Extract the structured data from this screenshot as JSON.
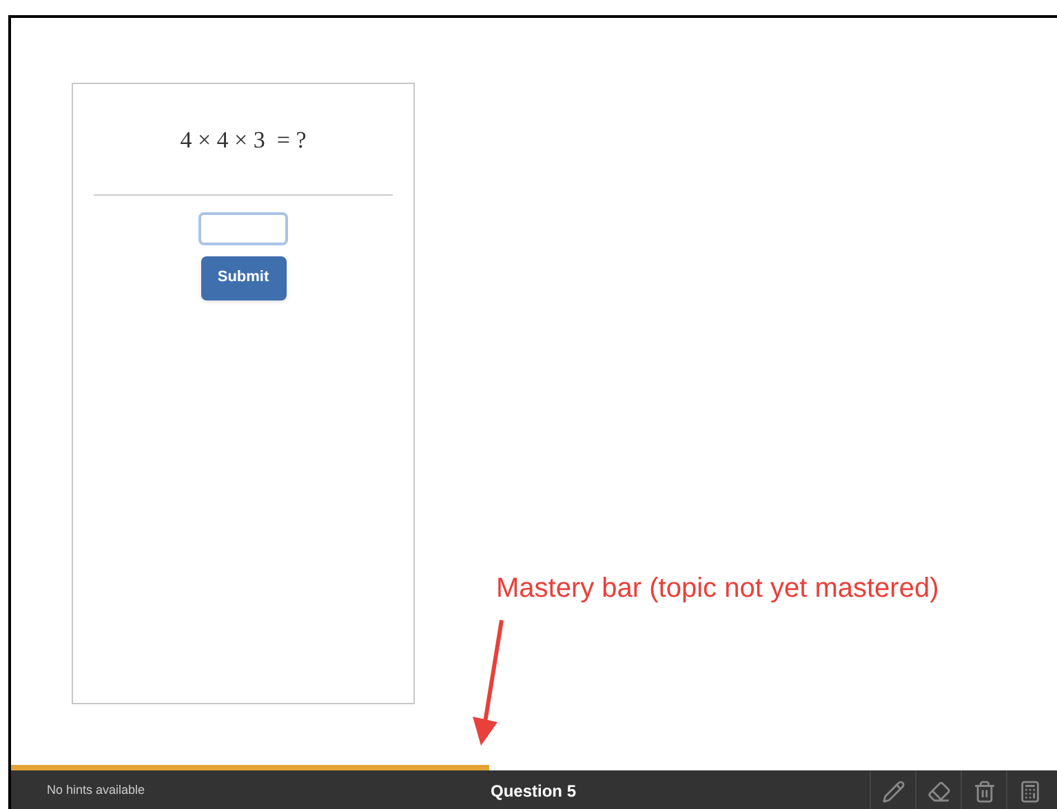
{
  "question": {
    "expression": "4 × 4 × 3  = ?",
    "submit": "Submit"
  },
  "mastery_bar": {
    "level": 0.45
  },
  "annotation": {
    "text": "Mastery bar (topic not yet mastered)"
  },
  "footer": {
    "hints": "No hints available",
    "title": "Question 5",
    "tools": [
      {
        "kind": "pencil"
      },
      {
        "kind": "eraser"
      },
      {
        "kind": "trash"
      },
      {
        "kind": "calculator"
      }
    ]
  }
}
